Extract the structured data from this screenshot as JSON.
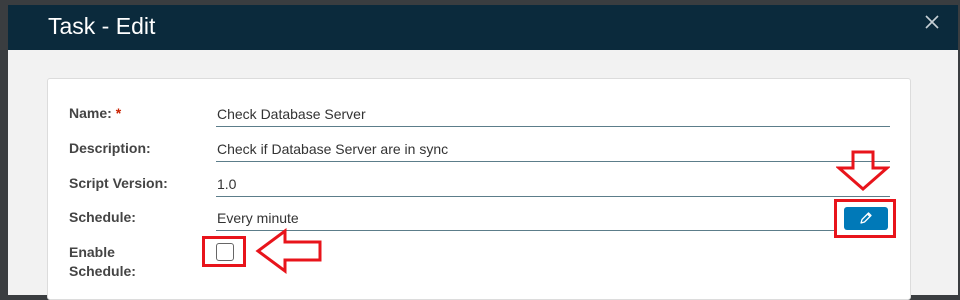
{
  "dialog": {
    "title": "Task - Edit"
  },
  "form": {
    "name_label": "Name:",
    "required_mark": "*",
    "name_value": "Check Database Server",
    "description_label": "Description:",
    "description_value": "Check if Database Server are in sync",
    "script_version_label": "Script Version:",
    "script_version_value": "1.0",
    "schedule_label": "Schedule:",
    "schedule_value": "Every minute",
    "enable_schedule_label_line1": "Enable",
    "enable_schedule_label_line2": "Schedule:",
    "enable_schedule_checked": false
  },
  "colors": {
    "header_bg": "#0b2a3c",
    "accent": "#0079b8",
    "annotation": "#e8141b"
  }
}
